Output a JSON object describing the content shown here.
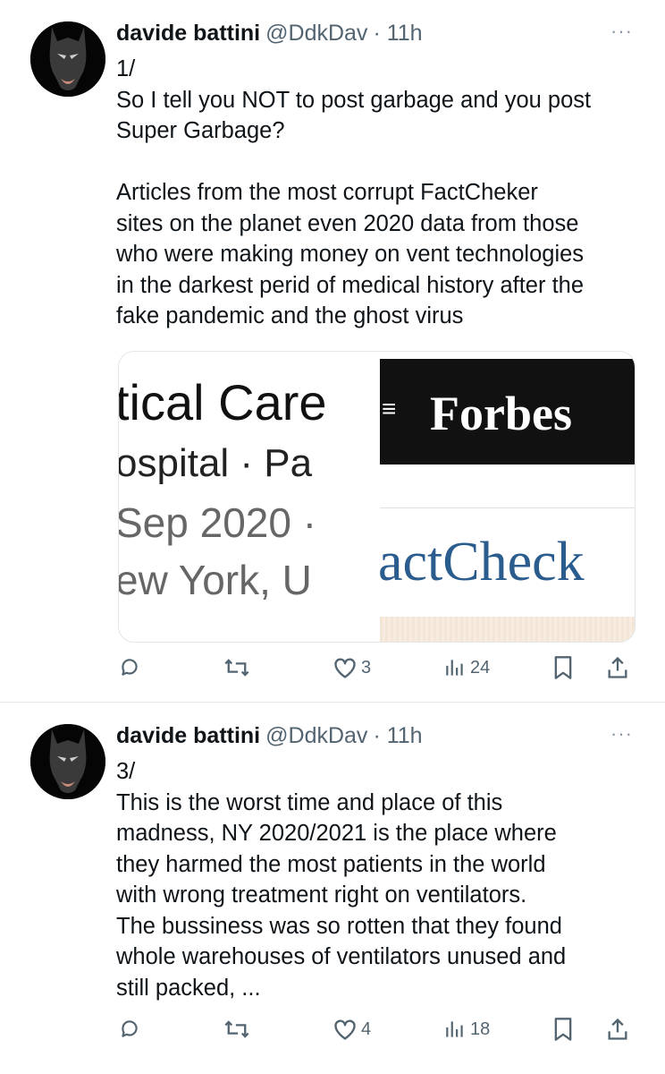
{
  "tweets": [
    {
      "name": "davide battini",
      "handle": "@DdkDav",
      "time": "· 11h",
      "more": "···",
      "lines": [
        "1/",
        "So I tell you NOT to post garbage and you post",
        "Super Garbage?",
        "",
        "Articles from the most corrupt FactCheker",
        "sites on the planet even 2020 data from those",
        "who were making money on vent technologies",
        "in the darkest perid of medical history after the",
        "fake pandemic and the ghost virus"
      ],
      "media": {
        "left_lines": [
          "tical Care",
          "ospital · Pa",
          "Sep 2020 ·",
          "ew York, U"
        ],
        "brand": "Forbes",
        "menu_icon": "≡",
        "brand_text": "actCheck"
      },
      "stats": {
        "replies": "",
        "reposts": "",
        "likes": "3",
        "views": "24"
      }
    },
    {
      "name": "davide battini",
      "handle": "@DdkDav",
      "time": "· 11h",
      "more": "···",
      "lines": [
        "3/",
        "This is the worst time and place of this",
        "madness, NY 2020/2021 is the place where",
        "they harmed the most patients in the world",
        "with wrong treatment right on ventilators.",
        "The bussiness was so rotten that they found",
        "whole warehouses of ventilators unused and",
        "still packed, ..."
      ],
      "stats": {
        "replies": "",
        "reposts": "",
        "likes": "4",
        "views": "18"
      }
    }
  ],
  "icons": [
    "reply-icon",
    "repost-icon",
    "like-icon",
    "views-icon",
    "bookmark-icon",
    "share-icon",
    "more-icon"
  ],
  "colors": {
    "text": "#0f1419",
    "secondary": "#536471",
    "divider": "#e6e9ec",
    "factcheck_blue": "#2b5c8e"
  }
}
